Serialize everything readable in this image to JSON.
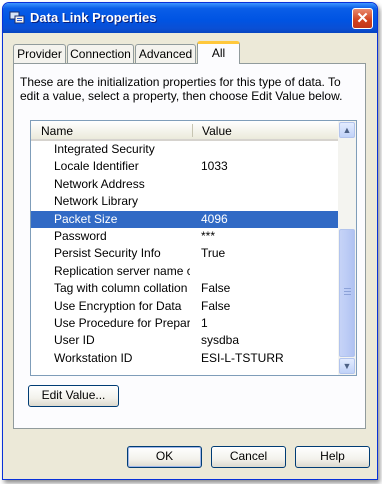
{
  "window": {
    "title": "Data Link Properties"
  },
  "tabs": [
    {
      "label": "Provider"
    },
    {
      "label": "Connection"
    },
    {
      "label": "Advanced"
    },
    {
      "label": "All"
    }
  ],
  "active_tab": "All",
  "description": "These are the initialization properties for this type of data.  To edit a value, select a property, then choose Edit Value below.",
  "list": {
    "columns": {
      "name": "Name",
      "value": "Value"
    },
    "rows": [
      {
        "name": "Integrated Security",
        "value": ""
      },
      {
        "name": "Locale Identifier",
        "value": "1033"
      },
      {
        "name": "Network Address",
        "value": ""
      },
      {
        "name": "Network Library",
        "value": ""
      },
      {
        "name": "Packet Size",
        "value": "4096"
      },
      {
        "name": "Password",
        "value": "***"
      },
      {
        "name": "Persist Security Info",
        "value": "True"
      },
      {
        "name": "Replication server name c...",
        "value": ""
      },
      {
        "name": "Tag with column collation ...",
        "value": "False"
      },
      {
        "name": "Use Encryption for Data",
        "value": "False"
      },
      {
        "name": "Use Procedure for Prepare",
        "value": "1"
      },
      {
        "name": "User ID",
        "value": "sysdba"
      },
      {
        "name": "Workstation ID",
        "value": "ESI-L-TSTURR"
      }
    ],
    "selected_row": "Packet Size"
  },
  "buttons": {
    "edit_value": "Edit Value...",
    "ok": "OK",
    "cancel": "Cancel",
    "help": "Help"
  },
  "icons": {
    "app": "data-link-icon",
    "close": "close-icon",
    "scroll_up": "scroll-up-arrow-icon",
    "scroll_down": "scroll-down-arrow-icon"
  },
  "colors": {
    "titlebar": "#0054e3",
    "selection": "#316ac5",
    "active_tab_accent": "#ffc83c"
  }
}
